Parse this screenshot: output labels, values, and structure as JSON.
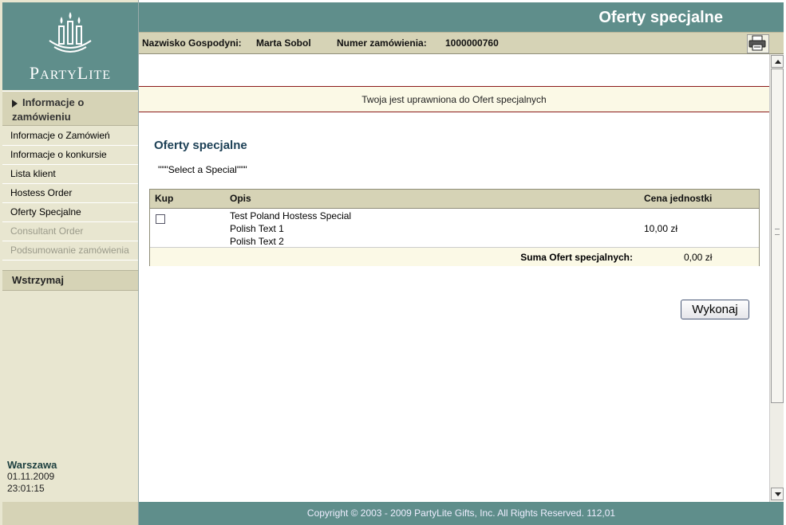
{
  "brand": {
    "logo_text_p": "P",
    "logo_text_arty": "ARTY",
    "logo_text_l": "L",
    "logo_text_ite": "ITE"
  },
  "header": {
    "title": "Oferty specjalne"
  },
  "infobar": {
    "hostess_label": "Nazwisko Gospodyni:",
    "hostess_value": "Marta Sobol",
    "order_label": "Numer zamówienia:",
    "order_value": "1000000760"
  },
  "sidebar": {
    "section_title": "Informacje o zamówieniu",
    "items": [
      {
        "label": "Informacje o Zamówień",
        "enabled": true
      },
      {
        "label": "Informacje o konkursie",
        "enabled": true
      },
      {
        "label": "Lista klient",
        "enabled": true
      },
      {
        "label": "Hostess Order",
        "enabled": true
      },
      {
        "label": "Oferty Specjalne",
        "enabled": true
      },
      {
        "label": "Consultant Order",
        "enabled": false
      },
      {
        "label": "Podsumowanie zamówienia",
        "enabled": false
      }
    ],
    "hold_label": "Wstrzymaj",
    "location": {
      "city": "Warszawa",
      "date": "01.11.2009",
      "time": "23:01:15"
    }
  },
  "notice": "Twoja jest uprawniona do Ofert specjalnych",
  "main": {
    "section_title": "Oferty specjalne",
    "select_label": "\"\"\"Select a Special\"\"\"",
    "table": {
      "headers": {
        "buy": "Kup",
        "desc": "Opis",
        "price": "Cena jednostki"
      },
      "rows": [
        {
          "desc_lines": [
            "Test Poland Hostess Special",
            "Polish Text 1",
            "Polish Text 2"
          ],
          "price": "10,00 zł",
          "checked": false
        }
      ],
      "sum_label": "Suma Ofert specjalnych:",
      "sum_value": "0,00 zł"
    },
    "run_button": "Wykonaj"
  },
  "footer": "Copyright © 2003 - 2009 PartyLite Gifts, Inc. All Rights Reserved.  112,01",
  "colors": {
    "teal": "#5f8e8b",
    "beige": "#d6d3b6",
    "notice_border": "#8b1a1a"
  },
  "icons": [
    "printer-icon",
    "chevron-up-icon",
    "chevron-down-icon",
    "candle-logo-icon",
    "triangle-right-icon",
    "checkbox"
  ]
}
